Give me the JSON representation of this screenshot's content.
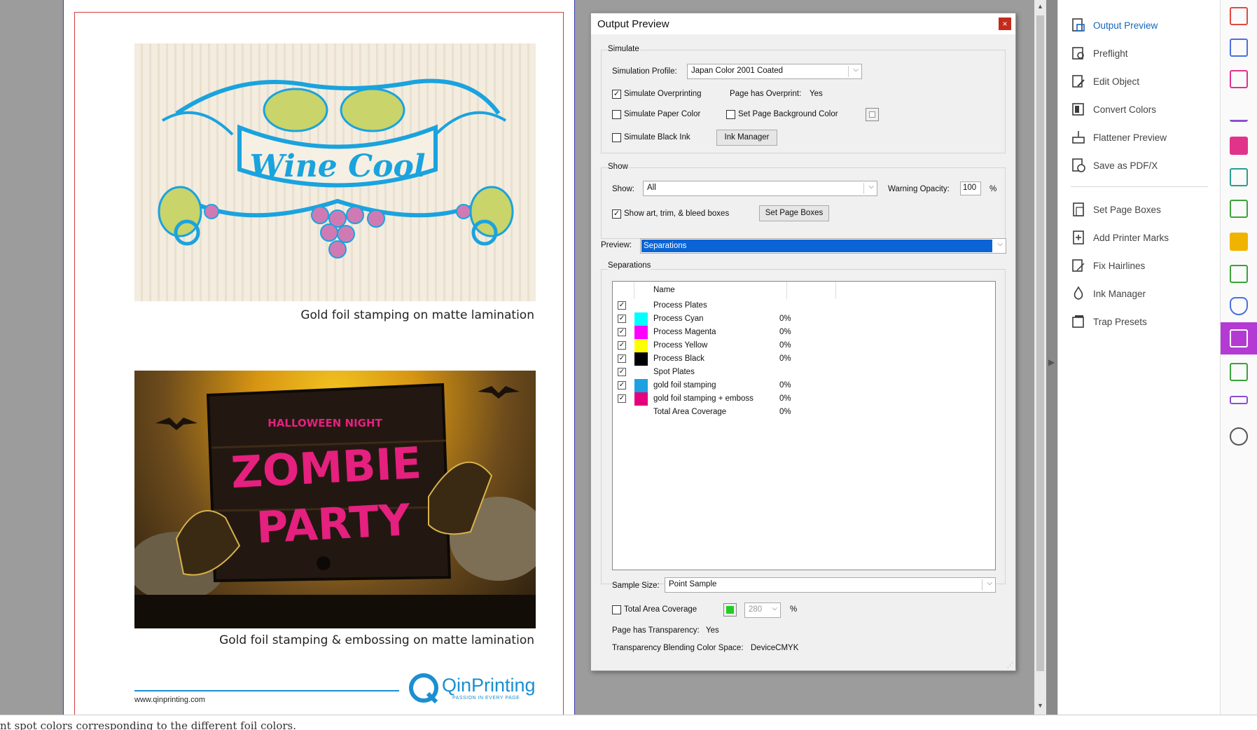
{
  "document": {
    "caption_1": "Gold foil stamping on matte lamination",
    "caption_2": "Gold foil stamping & embossing on matte lamination",
    "wine_title": "Wine Cool",
    "zombie_top": "HALLOWEEN NIGHT",
    "zombie_line1": "ZOMBIE",
    "zombie_line2": "PARTY",
    "footer_url": "www.qinprinting.com",
    "brand_name": "QinPrinting",
    "brand_tagline": "PASSION IN EVERY PAGE",
    "bottom_text": "nt spot colors corresponding to the different foil colors."
  },
  "dialog": {
    "title": "Output Preview",
    "close": "×",
    "simulate": {
      "group_title": "Simulate",
      "profile_label": "Simulation Profile:",
      "profile_value": "Japan Color 2001 Coated",
      "overprint_label": "Simulate Overprinting",
      "overprint_checked": "✓",
      "page_overprint_label": "Page has Overprint:",
      "page_overprint_value": "Yes",
      "paper_color_label": "Simulate Paper Color",
      "bg_color_label": "Set Page Background Color",
      "black_ink_label": "Simulate Black Ink",
      "ink_manager_btn": "Ink Manager"
    },
    "show": {
      "group_title": "Show",
      "show_label": "Show:",
      "show_value": "All",
      "warning_label": "Warning Opacity:",
      "warning_value": "100",
      "warning_unit": "%",
      "boxes_label": "Show art, trim, & bleed boxes",
      "boxes_checked": "✓",
      "set_boxes_btn": "Set Page Boxes"
    },
    "preview": {
      "label": "Preview:",
      "value": "Separations"
    },
    "separations": {
      "group_title": "Separations",
      "col_name": "Name",
      "rows": [
        {
          "name": "Process Plates",
          "pct": "",
          "color": "",
          "check": "✓"
        },
        {
          "name": "Process Cyan",
          "pct": "0%",
          "color": "#00ffff",
          "check": "✓"
        },
        {
          "name": "Process Magenta",
          "pct": "0%",
          "color": "#ff00ff",
          "check": "✓"
        },
        {
          "name": "Process Yellow",
          "pct": "0%",
          "color": "#ffff00",
          "check": "✓"
        },
        {
          "name": "Process Black",
          "pct": "0%",
          "color": "#000000",
          "check": "✓"
        },
        {
          "name": "Spot Plates",
          "pct": "",
          "color": "",
          "check": "✓"
        },
        {
          "name": "gold foil stamping",
          "pct": "0%",
          "color": "#1ba1e2",
          "check": "✓"
        },
        {
          "name": "gold foil stamping + emboss",
          "pct": "0%",
          "color": "#e5007e",
          "check": "✓"
        },
        {
          "name": "Total Area Coverage",
          "pct": "0%",
          "color": "",
          "check": ""
        }
      ]
    },
    "sample_size_label": "Sample Size:",
    "sample_size_value": "Point Sample",
    "tac_label": "Total Area Coverage",
    "tac_value": "280",
    "tac_unit": "%",
    "transparency_label": "Page has Transparency:",
    "transparency_value": "Yes",
    "blend_label": "Transparency Blending Color Space:",
    "blend_value": "DeviceCMYK"
  },
  "tools": {
    "items": [
      {
        "label": "Output Preview",
        "icon": "output-preview-icon"
      },
      {
        "label": "Preflight",
        "icon": "preflight-icon"
      },
      {
        "label": "Edit Object",
        "icon": "edit-object-icon"
      },
      {
        "label": "Convert Colors",
        "icon": "convert-colors-icon"
      },
      {
        "label": "Flattener Preview",
        "icon": "flattener-preview-icon"
      },
      {
        "label": "Save as PDF/X",
        "icon": "save-pdfx-icon"
      },
      {
        "label": "Set Page Boxes",
        "icon": "set-page-boxes-icon"
      },
      {
        "label": "Add Printer Marks",
        "icon": "add-printer-marks-icon"
      },
      {
        "label": "Fix Hairlines",
        "icon": "fix-hairlines-icon"
      },
      {
        "label": "Ink Manager",
        "icon": "ink-manager-icon"
      },
      {
        "label": "Trap Presets",
        "icon": "trap-presets-icon"
      }
    ]
  },
  "colors": {
    "accent": "#1565c0",
    "rail_active": "#b33bd4",
    "preview_highlight": "#0a64d6"
  }
}
